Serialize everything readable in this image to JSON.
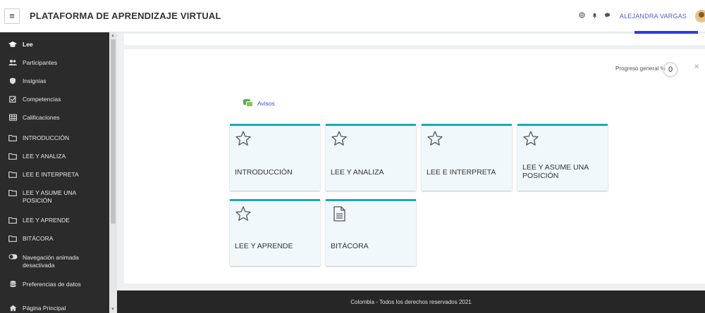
{
  "navbar": {
    "menu_icon": "hamburger-icon",
    "site_title": "PLATAFORMA DE APRENDIZAJE VIRTUAL",
    "icons": [
      "globe-icon",
      "bell-icon",
      "chat-icon"
    ],
    "username": "ALEJANDRA VARGAS"
  },
  "sidebar": {
    "items": [
      {
        "label": "Lee",
        "icon": "graduation-cap-icon"
      },
      {
        "label": "Participantes",
        "icon": "users-icon"
      },
      {
        "label": "Insignias",
        "icon": "shield-icon"
      },
      {
        "label": "Competencias",
        "icon": "checkbox-icon"
      },
      {
        "label": "Calificaciones",
        "icon": "table-icon"
      },
      {
        "label": "INTRODUCCIÓN",
        "icon": "folder-icon"
      },
      {
        "label": "LEE Y ANALIZA",
        "icon": "folder-icon"
      },
      {
        "label": "LEE E INTERPRETA",
        "icon": "folder-icon"
      },
      {
        "label": "LEE Y ASUME UNA",
        "label2": "POSICIÓN",
        "icon": "folder-icon"
      },
      {
        "label": "LEE Y APRENDE",
        "icon": "folder-icon"
      },
      {
        "label": "BITÁCORA",
        "icon": "folder-icon"
      },
      {
        "label": "Navegación animada",
        "label2": "desactivada",
        "icon": "toggle-icon"
      },
      {
        "label": "Preferencias de datos",
        "icon": "database-icon"
      },
      {
        "label": "Página Principal",
        "icon": "home-icon"
      }
    ]
  },
  "main": {
    "progress_label": "Progreso general %",
    "progress_value": "0",
    "avisos_label": "Avisos",
    "tiles": [
      {
        "label": "INTRODUCCIÓN",
        "icon": "star-icon"
      },
      {
        "label": "LEE Y ANALIZA",
        "icon": "star-icon"
      },
      {
        "label": "LEE E INTERPRETA",
        "icon": "star-icon"
      },
      {
        "label": "LEE Y ASUME UNA",
        "label2": "POSICIÓN",
        "icon": "star-icon"
      },
      {
        "label": "LEE Y APRENDE",
        "icon": "star-icon"
      },
      {
        "label": "BITÁCORA",
        "icon": "document-icon"
      }
    ]
  },
  "footer": {
    "text": "Colombia - Todos los derechos reservados 2021"
  },
  "colors": {
    "accent": "#1ba7c1",
    "link": "#3a4fcf",
    "sidebar_bg": "#2b2b2b",
    "footer_bg": "#262626"
  }
}
